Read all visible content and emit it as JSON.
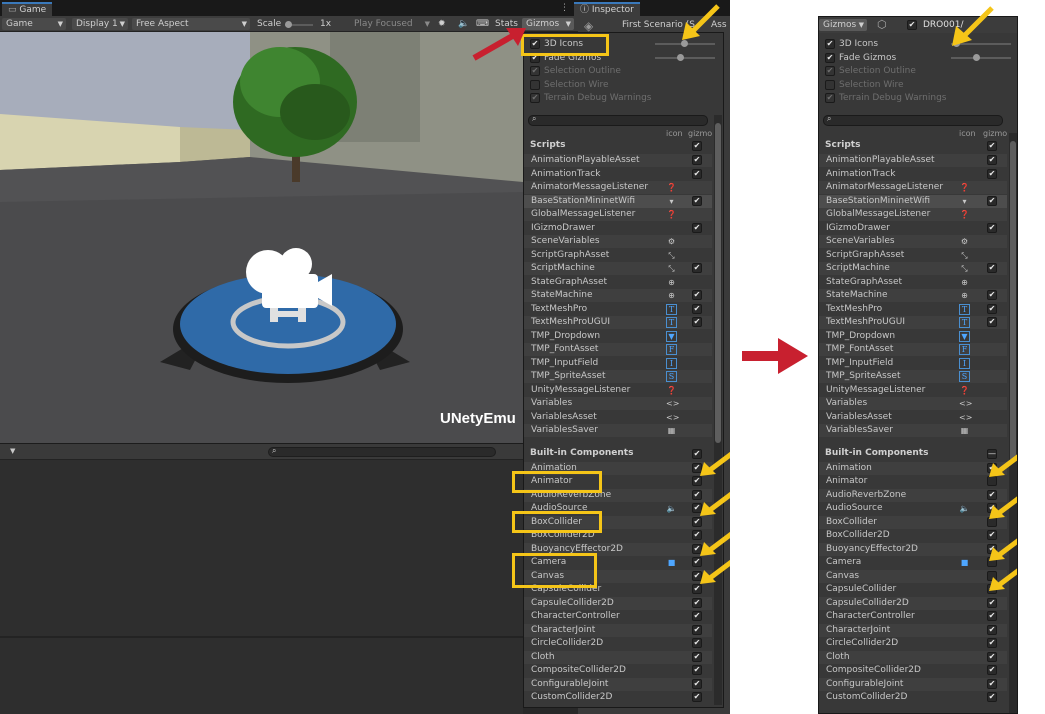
{
  "tabs": {
    "game": "Game",
    "inspector": "Inspector"
  },
  "toolbar": {
    "display_mode": "Game",
    "display": "Display 1",
    "aspect": "Free Aspect",
    "scale_label": "Scale",
    "scale_value": "1x",
    "play_focused": "Play Focused",
    "stats": "Stats",
    "gizmos": "Gizmos"
  },
  "inspector": {
    "title_left": "First Scenario (S",
    "title_right": "Ass"
  },
  "right_header": {
    "gizmos": "Gizmos",
    "object_name": "DRO001/"
  },
  "scene": {
    "overlay_text": "UNetyEmu"
  },
  "options": [
    {
      "label": "3D Icons",
      "checked": true,
      "enabled": true
    },
    {
      "label": "Fade Gizmos",
      "checked": true,
      "enabled": true
    },
    {
      "label": "Selection Outline",
      "checked": true,
      "enabled": false
    },
    {
      "label": "Selection Wire",
      "checked": false,
      "enabled": false
    },
    {
      "label": "Terrain Debug Warnings",
      "checked": true,
      "enabled": false
    }
  ],
  "columns": {
    "icon": "icon",
    "gizmo": "gizmo"
  },
  "scripts_header": "Scripts",
  "scripts": [
    {
      "name": "AnimationPlayableAsset",
      "icon": "",
      "gizmo": true
    },
    {
      "name": "AnimationTrack",
      "icon": "",
      "gizmo": true
    },
    {
      "name": "AnimatorMessageListener",
      "icon": "ear",
      "gizmo": false
    },
    {
      "name": "BaseStationMininetWifi",
      "icon": "dropdown",
      "gizmo": true
    },
    {
      "name": "GlobalMessageListener",
      "icon": "ear",
      "gizmo": false
    },
    {
      "name": "IGizmoDrawer",
      "icon": "",
      "gizmo": true
    },
    {
      "name": "SceneVariables",
      "icon": "vars",
      "gizmo": false
    },
    {
      "name": "ScriptGraphAsset",
      "icon": "graph",
      "gizmo": false
    },
    {
      "name": "ScriptMachine",
      "icon": "graph",
      "gizmo": true
    },
    {
      "name": "StateGraphAsset",
      "icon": "state",
      "gizmo": false
    },
    {
      "name": "StateMachine",
      "icon": "state",
      "gizmo": true
    },
    {
      "name": "TextMeshPro",
      "icon": "T",
      "gizmo": true
    },
    {
      "name": "TextMeshProUGUI",
      "icon": "T",
      "gizmo": true
    },
    {
      "name": "TMP_Dropdown",
      "icon": "▼",
      "gizmo": false
    },
    {
      "name": "TMP_FontAsset",
      "icon": "F",
      "gizmo": false
    },
    {
      "name": "TMP_InputField",
      "icon": "I",
      "gizmo": false
    },
    {
      "name": "TMP_SpriteAsset",
      "icon": "S",
      "gizmo": false
    },
    {
      "name": "UnityMessageListener",
      "icon": "ear",
      "gizmo": false
    },
    {
      "name": "Variables",
      "icon": "<>",
      "gizmo": false
    },
    {
      "name": "VariablesAsset",
      "icon": "<>",
      "gizmo": false
    },
    {
      "name": "VariablesSaver",
      "icon": "saver",
      "gizmo": false
    }
  ],
  "builtin_header": "Built-in Components",
  "builtin_left": [
    {
      "name": "Animation",
      "icon": "",
      "gizmo": true
    },
    {
      "name": "Animator",
      "icon": "",
      "gizmo": true
    },
    {
      "name": "AudioReverbZone",
      "icon": "",
      "gizmo": true
    },
    {
      "name": "AudioSource",
      "icon": "speaker",
      "gizmo": true
    },
    {
      "name": "BoxCollider",
      "icon": "",
      "gizmo": true
    },
    {
      "name": "BoxCollider2D",
      "icon": "",
      "gizmo": true
    },
    {
      "name": "BuoyancyEffector2D",
      "icon": "",
      "gizmo": true
    },
    {
      "name": "Camera",
      "icon": "camera",
      "gizmo": true
    },
    {
      "name": "Canvas",
      "icon": "",
      "gizmo": true
    },
    {
      "name": "CapsuleCollider",
      "icon": "",
      "gizmo": true
    },
    {
      "name": "CapsuleCollider2D",
      "icon": "",
      "gizmo": true
    },
    {
      "name": "CharacterController",
      "icon": "",
      "gizmo": true
    },
    {
      "name": "CharacterJoint",
      "icon": "",
      "gizmo": true
    },
    {
      "name": "CircleCollider2D",
      "icon": "",
      "gizmo": true
    },
    {
      "name": "Cloth",
      "icon": "",
      "gizmo": true
    },
    {
      "name": "CompositeCollider2D",
      "icon": "",
      "gizmo": true
    },
    {
      "name": "ConfigurableJoint",
      "icon": "",
      "gizmo": true
    },
    {
      "name": "CustomCollider2D",
      "icon": "",
      "gizmo": true
    }
  ],
  "builtin_right": [
    {
      "name": "Animation",
      "icon": "",
      "gizmo": true
    },
    {
      "name": "Animator",
      "icon": "",
      "gizmo": false
    },
    {
      "name": "AudioReverbZone",
      "icon": "",
      "gizmo": true
    },
    {
      "name": "AudioSource",
      "icon": "speaker",
      "gizmo": true
    },
    {
      "name": "BoxCollider",
      "icon": "",
      "gizmo": false
    },
    {
      "name": "BoxCollider2D",
      "icon": "",
      "gizmo": true
    },
    {
      "name": "BuoyancyEffector2D",
      "icon": "",
      "gizmo": true
    },
    {
      "name": "Camera",
      "icon": "camera",
      "gizmo": false
    },
    {
      "name": "Canvas",
      "icon": "",
      "gizmo": false
    },
    {
      "name": "CapsuleCollider",
      "icon": "",
      "gizmo": true
    },
    {
      "name": "CapsuleCollider2D",
      "icon": "",
      "gizmo": true
    },
    {
      "name": "CharacterController",
      "icon": "",
      "gizmo": true
    },
    {
      "name": "CharacterJoint",
      "icon": "",
      "gizmo": true
    },
    {
      "name": "CircleCollider2D",
      "icon": "",
      "gizmo": true
    },
    {
      "name": "Cloth",
      "icon": "",
      "gizmo": true
    },
    {
      "name": "CompositeCollider2D",
      "icon": "",
      "gizmo": true
    },
    {
      "name": "ConfigurableJoint",
      "icon": "",
      "gizmo": true
    },
    {
      "name": "CustomCollider2D",
      "icon": "",
      "gizmo": true
    }
  ],
  "colors": {
    "highlight": "#f5c518",
    "red_arrow": "#c8202f",
    "panel_bg": "#383838",
    "accent_blue": "#4ea6ff",
    "helipad_blue": "#2f6aa8"
  }
}
